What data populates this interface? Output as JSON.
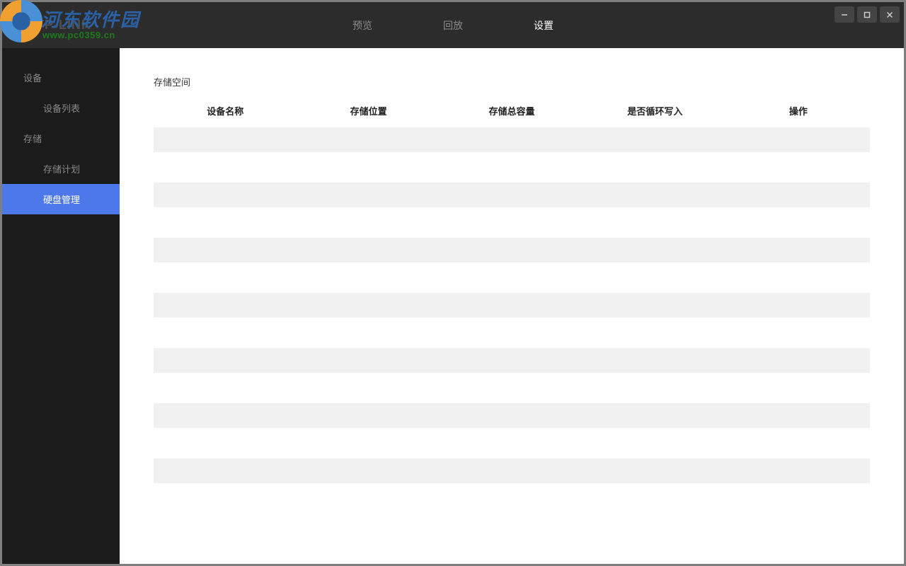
{
  "brand": "TP-LINK",
  "watermark": {
    "text": "河东软件园",
    "url": "www.pc0359.cn"
  },
  "tabs": [
    {
      "label": "预览",
      "active": false
    },
    {
      "label": "回放",
      "active": false
    },
    {
      "label": "设置",
      "active": true
    }
  ],
  "sidebar": {
    "groups": [
      {
        "label": "设备",
        "items": [
          {
            "label": "设备列表",
            "active": false
          }
        ]
      },
      {
        "label": "存储",
        "items": [
          {
            "label": "存储计划",
            "active": false
          },
          {
            "label": "硬盘管理",
            "active": true
          }
        ]
      }
    ]
  },
  "main": {
    "section_title": "存储空间",
    "columns": [
      {
        "label": "设备名称"
      },
      {
        "label": "存储位置"
      },
      {
        "label": "存储总容量"
      },
      {
        "label": "是否循环写入"
      },
      {
        "label": "操作"
      }
    ],
    "rows": [
      {
        "device_name": "",
        "location": "",
        "capacity": "",
        "loop": "",
        "action": ""
      },
      {
        "device_name": "",
        "location": "",
        "capacity": "",
        "loop": "",
        "action": ""
      },
      {
        "device_name": "",
        "location": "",
        "capacity": "",
        "loop": "",
        "action": ""
      },
      {
        "device_name": "",
        "location": "",
        "capacity": "",
        "loop": "",
        "action": ""
      },
      {
        "device_name": "",
        "location": "",
        "capacity": "",
        "loop": "",
        "action": ""
      },
      {
        "device_name": "",
        "location": "",
        "capacity": "",
        "loop": "",
        "action": ""
      },
      {
        "device_name": "",
        "location": "",
        "capacity": "",
        "loop": "",
        "action": ""
      }
    ]
  },
  "win_controls": {
    "minimize": "minimize",
    "maximize": "maximize",
    "close": "close"
  }
}
